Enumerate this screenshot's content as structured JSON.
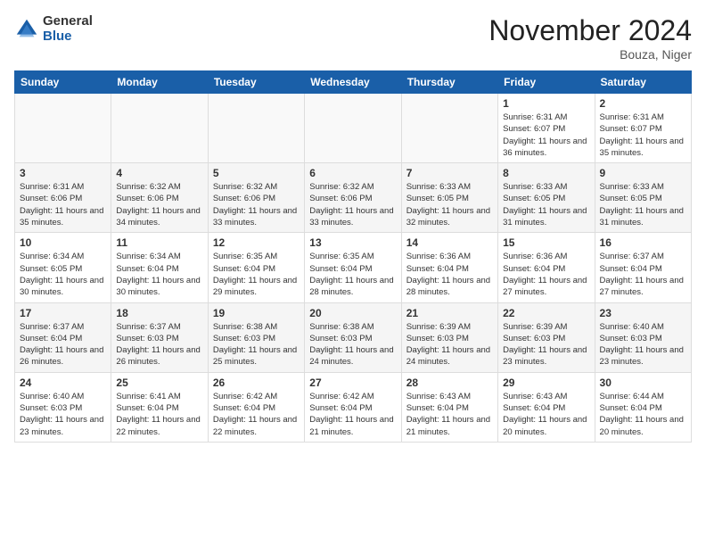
{
  "logo": {
    "general": "General",
    "blue": "Blue"
  },
  "title": "November 2024",
  "location": "Bouza, Niger",
  "days_of_week": [
    "Sunday",
    "Monday",
    "Tuesday",
    "Wednesday",
    "Thursday",
    "Friday",
    "Saturday"
  ],
  "weeks": [
    [
      {
        "day": "",
        "info": ""
      },
      {
        "day": "",
        "info": ""
      },
      {
        "day": "",
        "info": ""
      },
      {
        "day": "",
        "info": ""
      },
      {
        "day": "",
        "info": ""
      },
      {
        "day": "1",
        "info": "Sunrise: 6:31 AM\nSunset: 6:07 PM\nDaylight: 11 hours and 36 minutes."
      },
      {
        "day": "2",
        "info": "Sunrise: 6:31 AM\nSunset: 6:07 PM\nDaylight: 11 hours and 35 minutes."
      }
    ],
    [
      {
        "day": "3",
        "info": "Sunrise: 6:31 AM\nSunset: 6:06 PM\nDaylight: 11 hours and 35 minutes."
      },
      {
        "day": "4",
        "info": "Sunrise: 6:32 AM\nSunset: 6:06 PM\nDaylight: 11 hours and 34 minutes."
      },
      {
        "day": "5",
        "info": "Sunrise: 6:32 AM\nSunset: 6:06 PM\nDaylight: 11 hours and 33 minutes."
      },
      {
        "day": "6",
        "info": "Sunrise: 6:32 AM\nSunset: 6:06 PM\nDaylight: 11 hours and 33 minutes."
      },
      {
        "day": "7",
        "info": "Sunrise: 6:33 AM\nSunset: 6:05 PM\nDaylight: 11 hours and 32 minutes."
      },
      {
        "day": "8",
        "info": "Sunrise: 6:33 AM\nSunset: 6:05 PM\nDaylight: 11 hours and 31 minutes."
      },
      {
        "day": "9",
        "info": "Sunrise: 6:33 AM\nSunset: 6:05 PM\nDaylight: 11 hours and 31 minutes."
      }
    ],
    [
      {
        "day": "10",
        "info": "Sunrise: 6:34 AM\nSunset: 6:05 PM\nDaylight: 11 hours and 30 minutes."
      },
      {
        "day": "11",
        "info": "Sunrise: 6:34 AM\nSunset: 6:04 PM\nDaylight: 11 hours and 30 minutes."
      },
      {
        "day": "12",
        "info": "Sunrise: 6:35 AM\nSunset: 6:04 PM\nDaylight: 11 hours and 29 minutes."
      },
      {
        "day": "13",
        "info": "Sunrise: 6:35 AM\nSunset: 6:04 PM\nDaylight: 11 hours and 28 minutes."
      },
      {
        "day": "14",
        "info": "Sunrise: 6:36 AM\nSunset: 6:04 PM\nDaylight: 11 hours and 28 minutes."
      },
      {
        "day": "15",
        "info": "Sunrise: 6:36 AM\nSunset: 6:04 PM\nDaylight: 11 hours and 27 minutes."
      },
      {
        "day": "16",
        "info": "Sunrise: 6:37 AM\nSunset: 6:04 PM\nDaylight: 11 hours and 27 minutes."
      }
    ],
    [
      {
        "day": "17",
        "info": "Sunrise: 6:37 AM\nSunset: 6:04 PM\nDaylight: 11 hours and 26 minutes."
      },
      {
        "day": "18",
        "info": "Sunrise: 6:37 AM\nSunset: 6:03 PM\nDaylight: 11 hours and 26 minutes."
      },
      {
        "day": "19",
        "info": "Sunrise: 6:38 AM\nSunset: 6:03 PM\nDaylight: 11 hours and 25 minutes."
      },
      {
        "day": "20",
        "info": "Sunrise: 6:38 AM\nSunset: 6:03 PM\nDaylight: 11 hours and 24 minutes."
      },
      {
        "day": "21",
        "info": "Sunrise: 6:39 AM\nSunset: 6:03 PM\nDaylight: 11 hours and 24 minutes."
      },
      {
        "day": "22",
        "info": "Sunrise: 6:39 AM\nSunset: 6:03 PM\nDaylight: 11 hours and 23 minutes."
      },
      {
        "day": "23",
        "info": "Sunrise: 6:40 AM\nSunset: 6:03 PM\nDaylight: 11 hours and 23 minutes."
      }
    ],
    [
      {
        "day": "24",
        "info": "Sunrise: 6:40 AM\nSunset: 6:03 PM\nDaylight: 11 hours and 23 minutes."
      },
      {
        "day": "25",
        "info": "Sunrise: 6:41 AM\nSunset: 6:04 PM\nDaylight: 11 hours and 22 minutes."
      },
      {
        "day": "26",
        "info": "Sunrise: 6:42 AM\nSunset: 6:04 PM\nDaylight: 11 hours and 22 minutes."
      },
      {
        "day": "27",
        "info": "Sunrise: 6:42 AM\nSunset: 6:04 PM\nDaylight: 11 hours and 21 minutes."
      },
      {
        "day": "28",
        "info": "Sunrise: 6:43 AM\nSunset: 6:04 PM\nDaylight: 11 hours and 21 minutes."
      },
      {
        "day": "29",
        "info": "Sunrise: 6:43 AM\nSunset: 6:04 PM\nDaylight: 11 hours and 20 minutes."
      },
      {
        "day": "30",
        "info": "Sunrise: 6:44 AM\nSunset: 6:04 PM\nDaylight: 11 hours and 20 minutes."
      }
    ]
  ]
}
